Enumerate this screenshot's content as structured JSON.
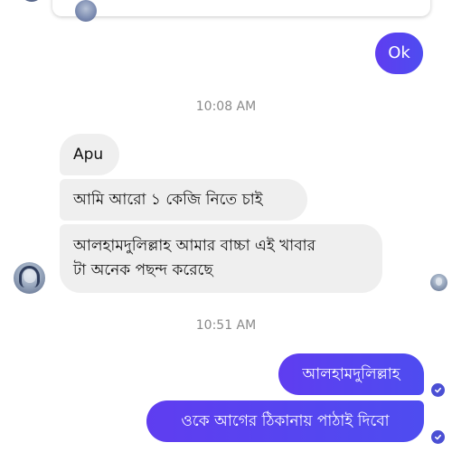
{
  "chat": {
    "messages": {
      "ok": "Ok",
      "apu": "Apu",
      "ami_aro": "আমি আরো ১ কেজি নিতে চাই",
      "alhamdulillah_line1": "আলহামদুলিল্লাহ আমার বাচ্চা এই খাবার",
      "alhamdulillah_line2": "টা অনেক পছন্দ করেছে",
      "reply_alhamdulillah": "আলহামদুলিল্লাহ",
      "reply_address": "ওকে আগের ঠিকানায় পাঠাই দিবো"
    },
    "timestamps": {
      "first": "10:08 AM",
      "second": "10:51 AM"
    }
  },
  "icons": {
    "avatar": "contact-avatar-icon",
    "seen": "seen-avatar-icon",
    "delivered": "delivered-check-icon"
  },
  "colors": {
    "outgoing_bubble": "#5b3cf0",
    "incoming_bubble": "#efefef",
    "timestamp_text": "#8a8a8a",
    "check": "#4b4fd4"
  }
}
